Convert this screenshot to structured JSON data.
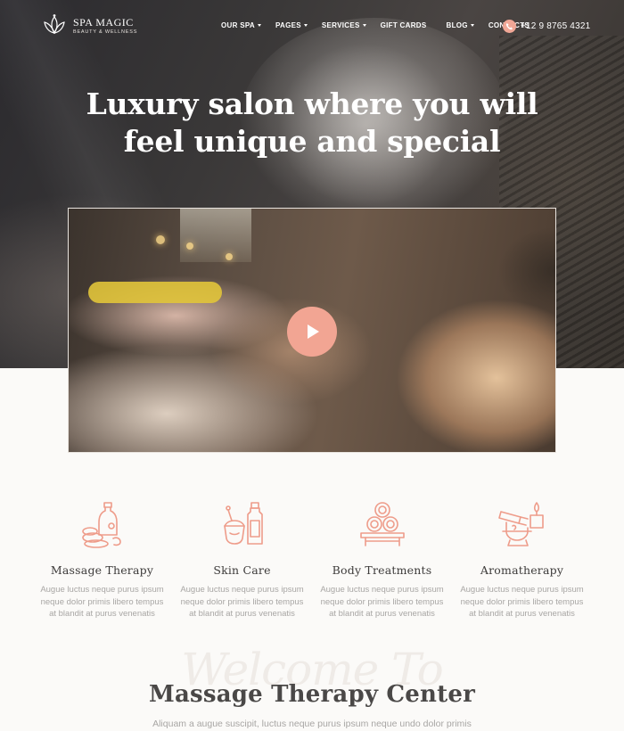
{
  "brand": {
    "name": "SPA MAGIC",
    "tagline": "BEAUTY & WELLNESS"
  },
  "nav": {
    "items": [
      {
        "label": "OUR SPA",
        "dropdown": true
      },
      {
        "label": "PAGES",
        "dropdown": true
      },
      {
        "label": "SERVICES",
        "dropdown": true
      },
      {
        "label": "GIFT CARDS",
        "dropdown": false
      },
      {
        "label": "BLOG",
        "dropdown": true
      },
      {
        "label": "CONTACTS",
        "dropdown": false
      }
    ],
    "phone": "+12 9 8765 4321"
  },
  "hero": {
    "title_line1": "Luxury salon where you will",
    "title_line2": "feel unique and special"
  },
  "video": {
    "play_icon": "play-icon"
  },
  "services": [
    {
      "icon": "massage-oil-stones-icon",
      "name": "Massage Therapy",
      "desc": "Augue luctus neque purus ipsum neque dolor primis libero tempus at blandit at purus venenatis"
    },
    {
      "icon": "skin-care-products-icon",
      "name": "Skin Care",
      "desc": "Augue luctus neque purus ipsum neque dolor primis libero tempus at blandit at purus venenatis"
    },
    {
      "icon": "rolled-towels-icon",
      "name": "Body Treatments",
      "desc": "Augue luctus neque purus ipsum neque dolor primis libero tempus at blandit at purus venenatis"
    },
    {
      "icon": "aroma-candle-icon",
      "name": "Aromatherapy",
      "desc": "Augue luctus neque purus ipsum neque dolor primis libero tempus at blandit at purus venenatis"
    }
  ],
  "welcome": {
    "script": "Welcome To",
    "title": "Massage Therapy Center",
    "subtitle": "Aliquam a augue suscipit, luctus neque purus ipsum neque undo dolor primis"
  },
  "colors": {
    "accent": "#f2a593",
    "icon_stroke": "#ee9c8a",
    "heading": "#3d3b3a",
    "muted_text": "#a8a6a4",
    "background": "#fbfaf8"
  }
}
